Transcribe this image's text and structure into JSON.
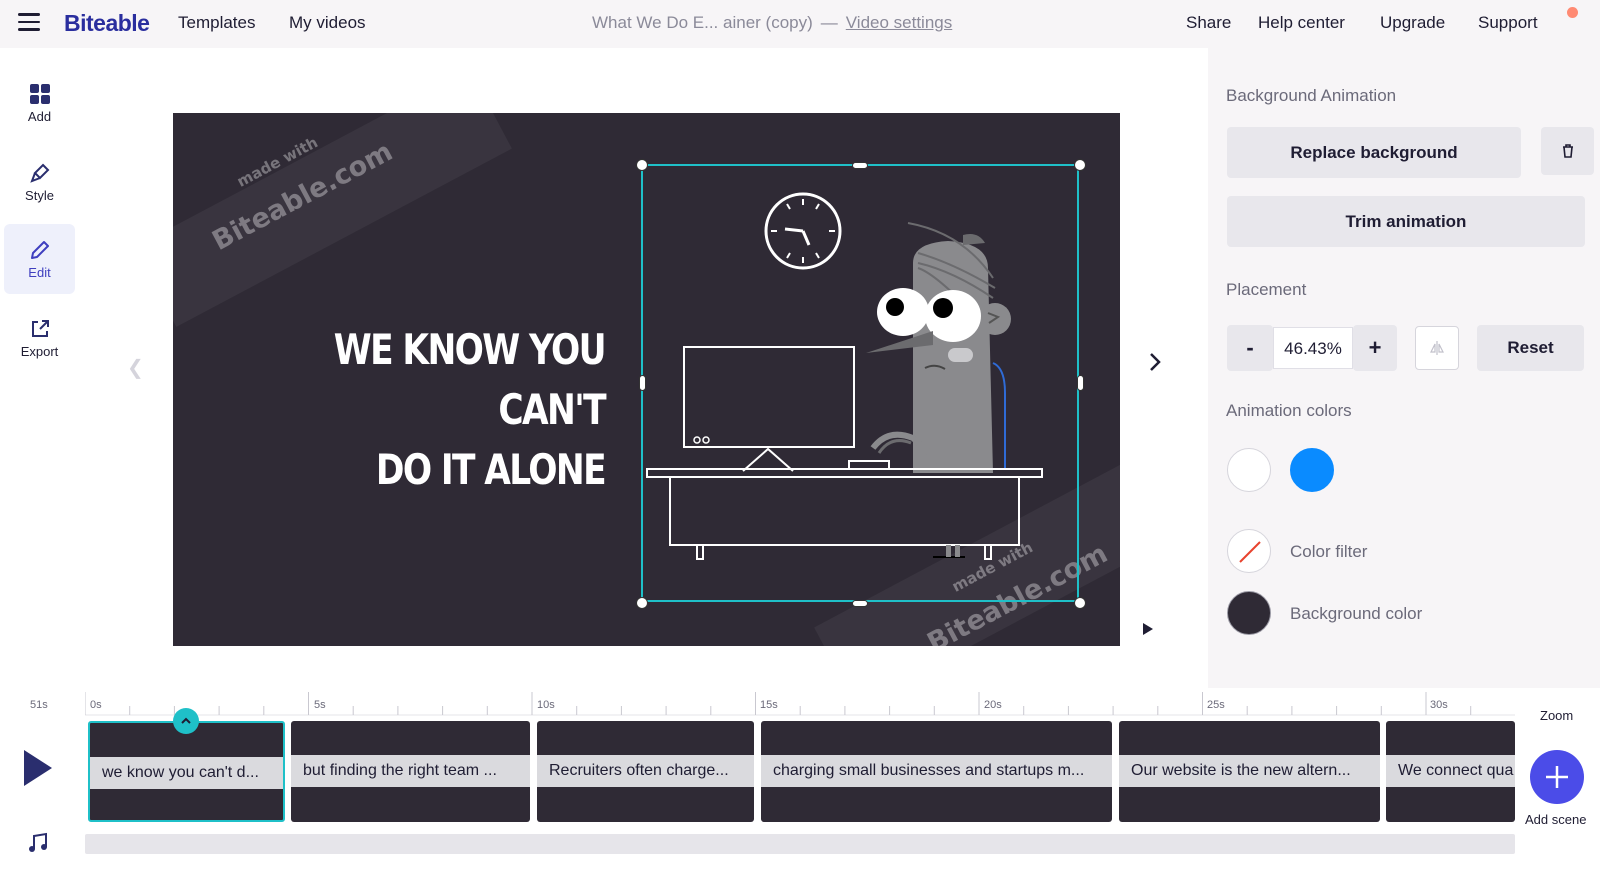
{
  "topbar": {
    "logo": "Biteable",
    "nav": [
      "Templates",
      "My videos"
    ],
    "video_title": "What We Do E... ainer (copy)",
    "separator": "—",
    "video_settings": "Video settings",
    "right_nav": [
      "Share",
      "Help center",
      "Upgrade",
      "Support"
    ]
  },
  "sidebar": {
    "items": [
      {
        "label": "Add",
        "icon": "grid-icon"
      },
      {
        "label": "Style",
        "icon": "brush-icon"
      },
      {
        "label": "Edit",
        "icon": "pencil-icon"
      },
      {
        "label": "Export",
        "icon": "export-icon"
      }
    ],
    "active": "Edit"
  },
  "canvas": {
    "headline_line1": "WE KNOW YOU CAN'T",
    "headline_line2": "DO IT ALONE",
    "watermark_small": "made with",
    "watermark_large": "Biteable.com"
  },
  "panel": {
    "bg_anim_title": "Background Animation",
    "replace_label": "Replace background",
    "trim_label": "Trim animation",
    "placement_title": "Placement",
    "minus": "-",
    "plus": "+",
    "placement_value": "46.43%",
    "reset_label": "Reset",
    "anim_colors_title": "Animation colors",
    "colors": [
      "#ffffff",
      "#0a8bff"
    ],
    "color_filter_label": "Color filter",
    "background_color_label": "Background color",
    "background_color": "#2f2a35"
  },
  "timeline": {
    "duration": "51s",
    "ticks": [
      "0s",
      "5s",
      "10s",
      "15s",
      "20s",
      "25s",
      "30s"
    ],
    "scenes": [
      "we know you can't d...",
      "but finding the right team ...",
      "Recruiters often charge...",
      "charging small businesses and startups m...",
      "Our website is the new altern...",
      "We connect qua"
    ],
    "zoom_label": "Zoom",
    "add_scene_label": "Add scene"
  }
}
